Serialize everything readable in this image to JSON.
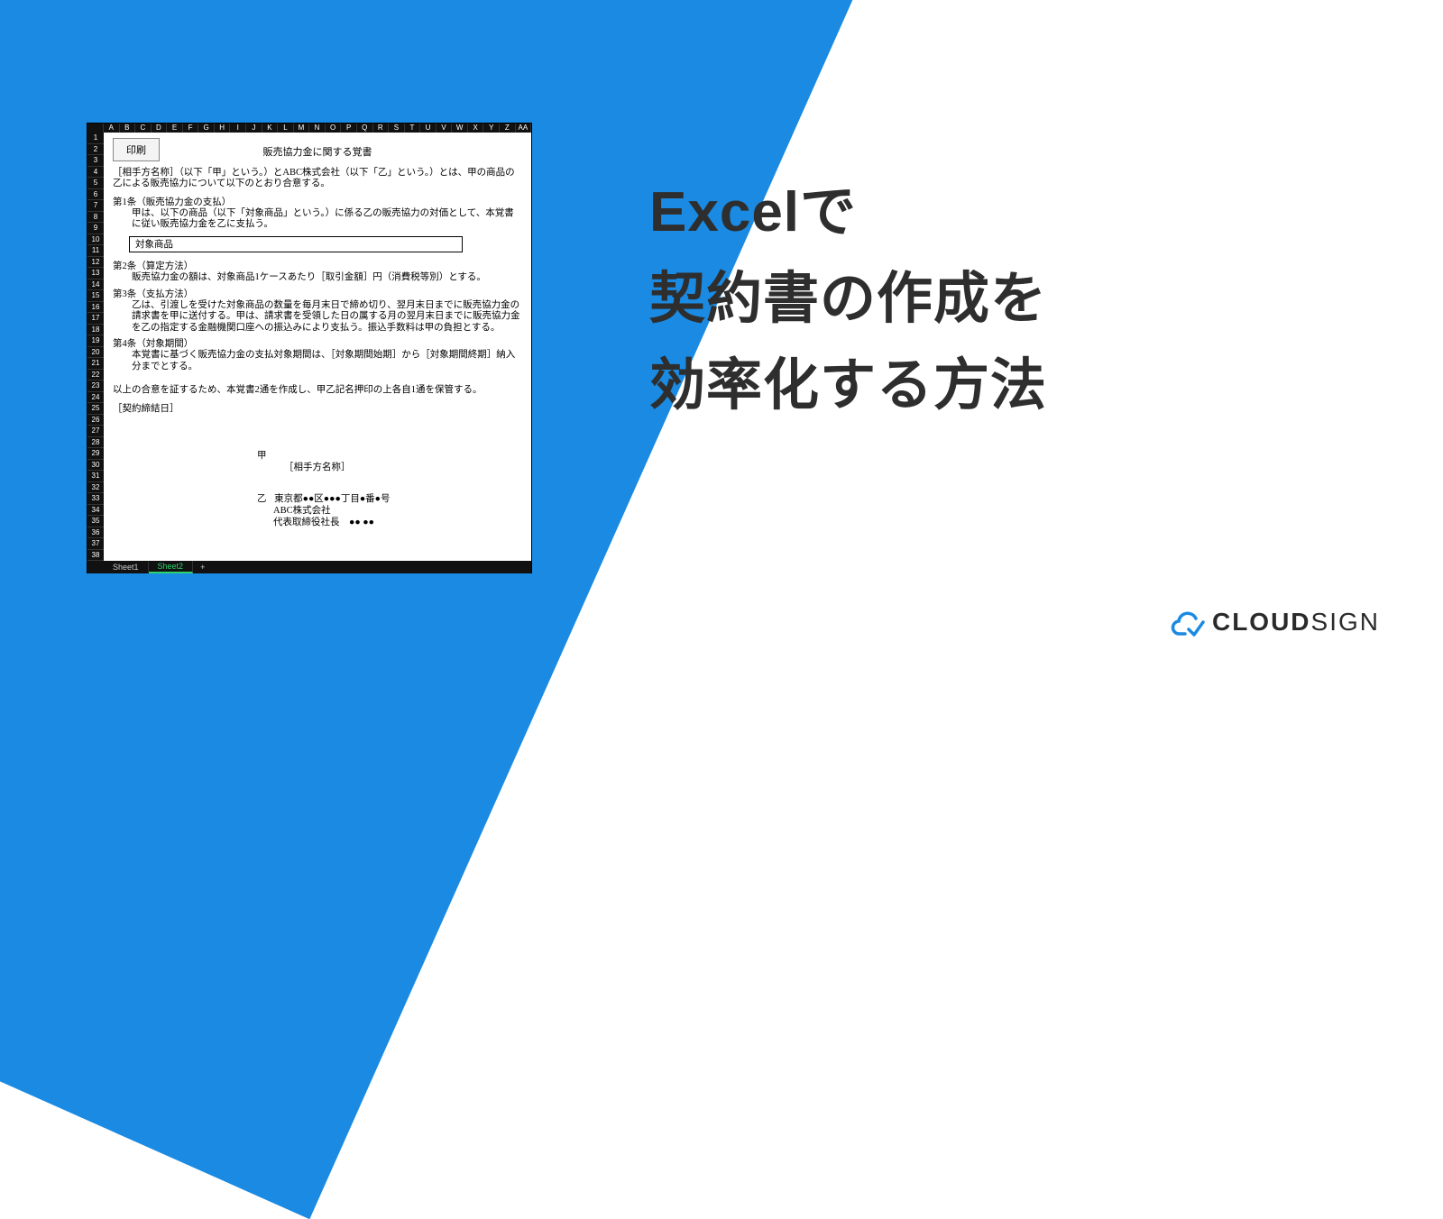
{
  "main_title_l1": "Excelで",
  "main_title_l2": "契約書の作成を",
  "main_title_l3": "効率化する方法",
  "logo": {
    "cloud": "CLOUD",
    "sign": "SIGN"
  },
  "excel": {
    "columns": [
      "A",
      "B",
      "C",
      "D",
      "E",
      "F",
      "G",
      "H",
      "I",
      "J",
      "K",
      "L",
      "M",
      "N",
      "O",
      "P",
      "Q",
      "R",
      "S",
      "T",
      "U",
      "V",
      "W",
      "X",
      "Y",
      "Z",
      "AA"
    ],
    "rows": [
      "1",
      "2",
      "3",
      "4",
      "5",
      "6",
      "7",
      "8",
      "9",
      "10",
      "11",
      "12",
      "13",
      "14",
      "15",
      "16",
      "17",
      "18",
      "19",
      "20",
      "21",
      "22",
      "23",
      "24",
      "25",
      "26",
      "27",
      "28",
      "29",
      "30",
      "31",
      "32",
      "33",
      "34",
      "35",
      "36",
      "37",
      "38"
    ],
    "print_btn": "印刷",
    "doc_title": "販売協力金に関する覚書",
    "intro": "［相手方名称］（以下「甲」という。）とABC株式会社（以下「乙」という。）とは、甲の商品の乙による販売協力について以下のとおり合意する。",
    "c1_h": "第1条（販売協力金の支払）",
    "c1_b": "甲は、以下の商品（以下「対象商品」という。）に係る乙の販売協力の対価として、本覚書に従い販売協力金を乙に支払う。",
    "target_label": "対象商品",
    "c2_h": "第2条（算定方法）",
    "c2_b": "販売協力金の額は、対象商品1ケースあたり［取引金額］円（消費税等別）とする。",
    "c3_h": "第3条（支払方法）",
    "c3_b": "乙は、引渡しを受けた対象商品の数量を毎月末日で締め切り、翌月末日までに販売協力金の請求書を甲に送付する。甲は、請求書を受領した日の属する月の翌月末日までに販売協力金を乙の指定する金融機関口座への振込みにより支払う。振込手数料は甲の負担とする。",
    "c4_h": "第4条（対象期間）",
    "c4_b": "本覚書に基づく販売協力金の支払対象期間は、［対象期間始期］から［対象期間終期］納入分までとする。",
    "closing": "以上の合意を証するため、本覚書2通を作成し、甲乙記名押印の上各自1通を保管する。",
    "date_label": "［契約締結日］",
    "sig_k": "甲",
    "sig_k_name": "［相手方名称］",
    "sig_o": "乙",
    "sig_o_addr": "東京都●●区●●●丁目●番●号",
    "sig_o_co": "ABC株式会社",
    "sig_o_rep": "代表取締役社長　●●  ●●",
    "tabs": {
      "sheet1": "Sheet1",
      "sheet2": "Sheet2",
      "plus": "+"
    }
  }
}
